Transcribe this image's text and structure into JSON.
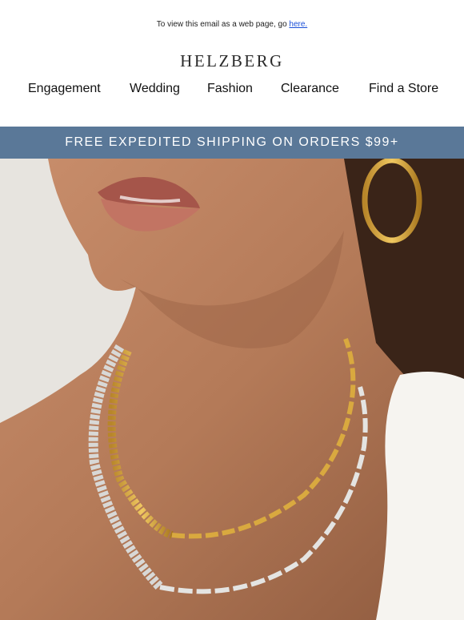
{
  "top": {
    "prefix": "To view this email as a web page, go ",
    "link": "here."
  },
  "brand": {
    "logo": "HELZBERG"
  },
  "nav": {
    "items": [
      "Engagement",
      "Wedding",
      "Fashion",
      "Clearance",
      "Find a Store"
    ]
  },
  "banner": {
    "text": "FREE EXPEDITED SHIPPING ON ORDERS $99+"
  },
  "colors": {
    "banner": "#5a7898",
    "link": "#1a4fd8"
  }
}
